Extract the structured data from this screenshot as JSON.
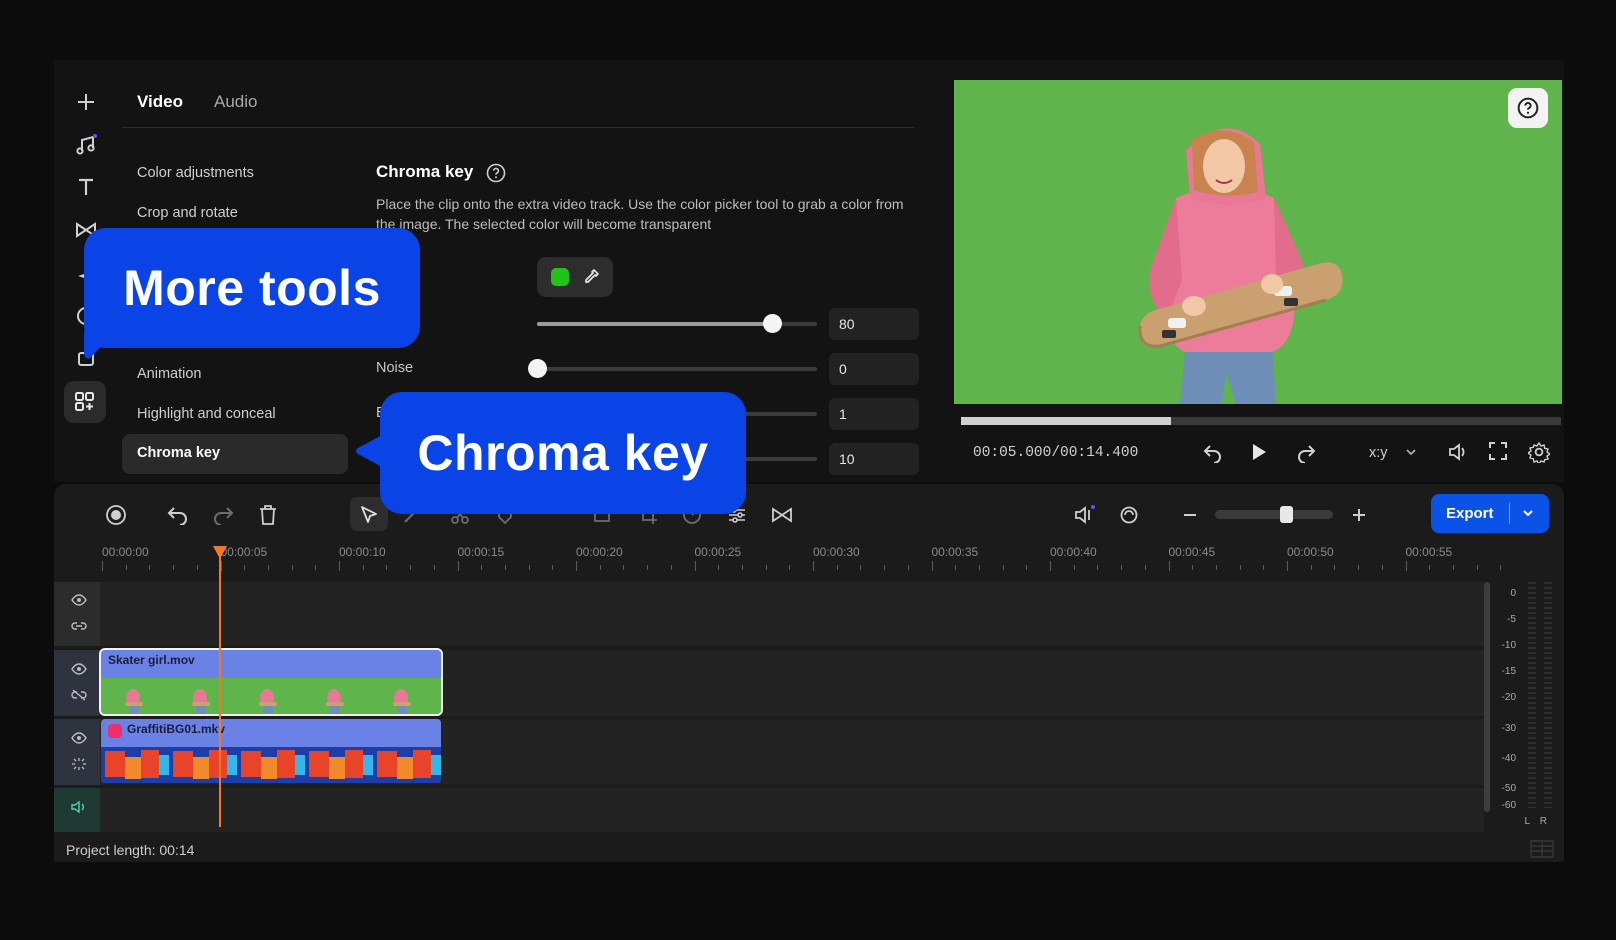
{
  "tabs": [
    {
      "label": "Video",
      "active": true
    },
    {
      "label": "Audio",
      "active": false
    }
  ],
  "side_menu": {
    "items": [
      "Color adjustments",
      "Crop and rotate",
      "Animation",
      "Highlight and conceal"
    ],
    "selected": "Chroma key"
  },
  "chroma": {
    "title": "Chroma key",
    "description": "Place the clip onto the extra video track. Use the color picker tool to grab a color from the image. The selected color will become transparent",
    "picker_color": "#21c21a",
    "rows": [
      {
        "label": "nce",
        "value": "80",
        "level": 0.84
      },
      {
        "label": "Noise",
        "value": "0",
        "level": 0.0
      },
      {
        "label": "E",
        "value": "1",
        "level": null
      },
      {
        "label": "",
        "value": "10",
        "level": null
      }
    ]
  },
  "preview": {
    "timecode": "00:05.000/00:14.400",
    "progress": 0.35,
    "aspect_label": "x:y",
    "background_color": "#5fb44b"
  },
  "timeline": {
    "export_label": "Export",
    "ruler": [
      "00:00:00",
      "00:00:05",
      "00:00:10",
      "00:00:15",
      "00:00:20",
      "00:00:25",
      "00:00:30",
      "00:00:35",
      "00:00:40",
      "00:00:45",
      "00:00:50",
      "00:00:55"
    ],
    "clips": [
      {
        "name": "Skater girl.mov",
        "color": "#6a82e6"
      },
      {
        "name": "GraffitiBG01.mkv",
        "color": "#6a82e6"
      }
    ],
    "meter_scale": [
      "0",
      "-5",
      "-10",
      "-15",
      "-20",
      "-30",
      "-40",
      "-50",
      "-60"
    ],
    "meter_channels": [
      "L",
      "R"
    ],
    "status": "Project length: 00:14",
    "playhead_time": "00:00:05"
  },
  "callouts": {
    "more_tools": "More tools",
    "chroma_key": "Chroma key"
  },
  "icons": [
    "plus-icon",
    "music-note-icon",
    "text-icon",
    "transition-icon",
    "sparkle-icon",
    "sticker-icon",
    "frame-icon",
    "more-tools-icon",
    "help-icon",
    "eyedropper-icon",
    "undo-icon",
    "redo-icon",
    "play-icon",
    "volume-icon",
    "fullscreen-icon",
    "settings-icon",
    "record-icon",
    "trash-icon",
    "select-arrow-icon",
    "cut-icon",
    "eye-icon",
    "link-icon"
  ]
}
